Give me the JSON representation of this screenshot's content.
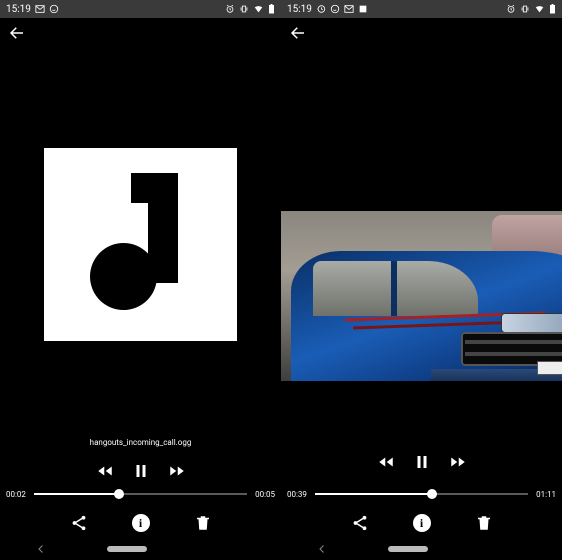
{
  "left": {
    "status": {
      "time": "15:19",
      "icons_left": [
        "mail-icon",
        "whatsapp-icon"
      ],
      "icons_right": [
        "alarm-icon",
        "vibrate-icon",
        "wifi-icon",
        "battery-icon"
      ]
    },
    "filename": "hangouts_incoming_call.ogg",
    "playback": {
      "elapsed": "00:02",
      "total": "00:05",
      "progress_pct": 40
    },
    "controls": {
      "prev": "rewind",
      "play": "pause",
      "next": "forward"
    },
    "actions": {
      "share": "Share",
      "info": "i",
      "delete": "Delete"
    }
  },
  "right": {
    "status": {
      "time": "15:19",
      "icons_left": [
        "history-icon",
        "whatsapp-icon",
        "mail-icon",
        "app-icon"
      ],
      "icons_right": [
        "alarm-icon",
        "vibrate-icon",
        "wifi-icon",
        "battery-icon"
      ]
    },
    "playback": {
      "elapsed": "00:39",
      "total": "01:11",
      "progress_pct": 55
    },
    "controls": {
      "prev": "rewind",
      "play": "pause",
      "next": "forward"
    },
    "actions": {
      "share": "Share",
      "info": "i",
      "delete": "Delete"
    },
    "media_description": "blue SUV car photo"
  }
}
